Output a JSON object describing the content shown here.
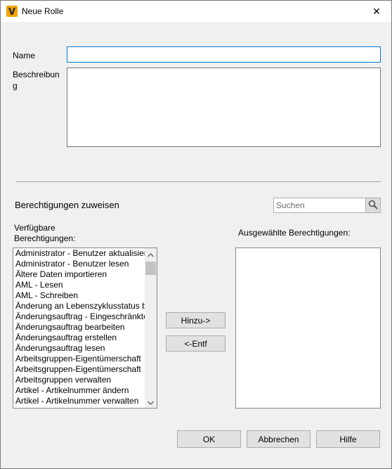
{
  "window": {
    "title": "Neue Rolle",
    "close_glyph": "✕",
    "app_icon": "vault-logo-icon",
    "app_icon_color": "#f2a400"
  },
  "form": {
    "name_label": "Name",
    "name_value": "",
    "description_label_line1": "Beschreibun",
    "description_label_line2": "g",
    "description_value": ""
  },
  "permissions": {
    "section_title": "Berechtigungen zuweisen",
    "search_placeholder": "Suchen",
    "search_icon": "magnifier-icon",
    "available_label_line1": "Verfügbare",
    "available_label_line2": "Berechtigungen:",
    "selected_label": "Ausgewählte Berechtigungen:",
    "available_items": [
      "Administrator - Benutzer aktualisieren",
      "Administrator - Benutzer lesen",
      "Ältere Daten importieren",
      "AML - Lesen",
      "AML - Schreiben",
      "Änderung an Lebenszyklusstatus bearbeiten",
      "Änderungsauftrag - Eingeschränkte Bearbeitung",
      "Änderungsauftrag bearbeiten",
      "Änderungsauftrag erstellen",
      "Änderungsauftrag lesen",
      "Arbeitsgruppen-Eigentümerschaft",
      "Arbeitsgruppen-Eigentümerschaft",
      "Arbeitsgruppen verwalten",
      "Artikel - Artikelnummer ändern",
      "Artikel - Artikelnummer verwalten"
    ],
    "selected_items": [],
    "add_button": "Hinzu->",
    "remove_button": "<-Entf"
  },
  "footer": {
    "ok_button": "OK",
    "cancel_button": "Abbrechen",
    "help_button": "Hilfe"
  }
}
